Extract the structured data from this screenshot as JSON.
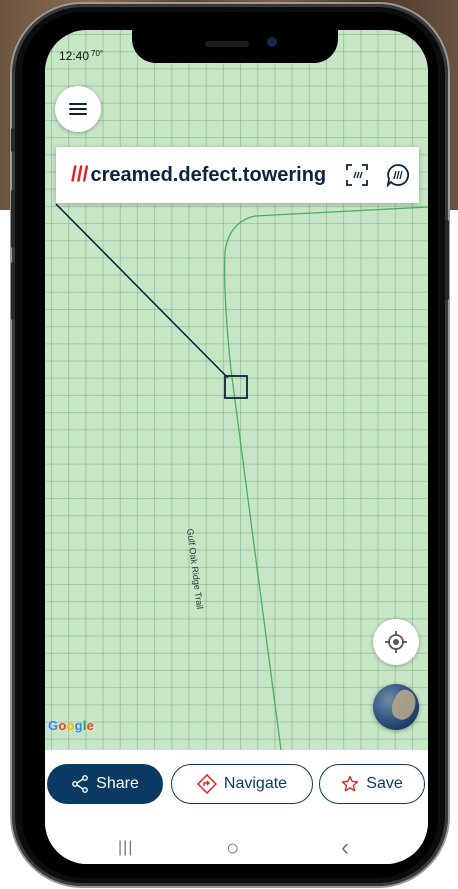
{
  "status_bar": {
    "time": "12:40",
    "temperature": "70°"
  },
  "address": {
    "slashes": "///",
    "words": "creamed.defect.towering"
  },
  "map": {
    "road_label": "Gulf Oak Ridge Trail",
    "attribution": "Google"
  },
  "actions": {
    "share": "Share",
    "navigate": "Navigate",
    "save": "Save"
  },
  "system_nav": {
    "recents": "|||",
    "home": "○",
    "back": "‹"
  },
  "icons": {
    "menu": "hamburger-menu-icon",
    "scan": "scan-address-icon",
    "voice": "voice-address-icon",
    "locate": "my-location-icon",
    "map_type": "satellite-view-icon",
    "share": "share-icon",
    "navigate": "navigate-icon",
    "save": "star-icon"
  },
  "colors": {
    "brand_red": "#e11f26",
    "navy": "#0a2540",
    "button_navy": "#0a3a62",
    "map_green": "#c6e6c5"
  }
}
